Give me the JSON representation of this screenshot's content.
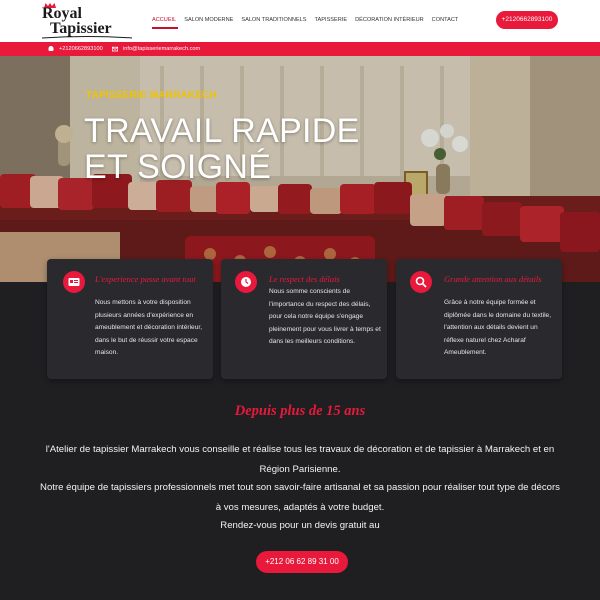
{
  "header": {
    "logo_line1": "Royal",
    "logo_line2": "Tapissier",
    "nav": [
      {
        "label": "Accueil"
      },
      {
        "label": "Salon moderne"
      },
      {
        "label": "Salon traditionnels"
      },
      {
        "label": "Tapisserie"
      },
      {
        "label": "Décoration intérieur"
      },
      {
        "label": "Contact"
      }
    ],
    "phone_button": "+2120662893100"
  },
  "topbar": {
    "phone": "+2120662893100",
    "email": "info@tapisseriemarrakech.com",
    "phone_icon": "phone-icon",
    "email_icon": "envelope-icon"
  },
  "hero": {
    "eyebrow": "TAPISSERIE MARRAKECH",
    "title": "TRAVAIL RAPIDE ET SOIGNÉ"
  },
  "features": [
    {
      "icon": "id-card-icon",
      "title": "L'experience passe avant tout",
      "text": "Nous mettons à votre disposition plusieurs années d'expérience en ameublement et décoration intérieur, dans le but de réussir votre espace maison."
    },
    {
      "icon": "clock-icon",
      "title": "Le respect des délais",
      "text": "Nous somme conscients de l'importance du respect des délais, pour cela notre équipe s'engage pleinement pour vous livrer à temps et dans les meilleurs conditions."
    },
    {
      "icon": "search-icon",
      "title": "Grande attention aux détails",
      "text": "Grâce à notre équipe formée et diplômée dans le domaine du textile, l'attention aux détails devient un réflexe naturel chez Acharaf Ameublement."
    }
  ],
  "about": {
    "title": "Depuis plus de 15 ans",
    "p1": "l'Atelier de tapissier Marrakech vous conseille et réalise tous les travaux de décoration et de tapissier à Marrakech et en Région Parisienne.",
    "p2": "Notre équipe de tapissiers professionnels met tout son savoir-faire artisanal et sa passion pour réaliser tout type de décors à vos mesures, adaptés à votre budget.",
    "p3": "Rendez-vous pour un devis gratuit au",
    "cta": "+212 06 62 89 31 00"
  },
  "colors": {
    "accent": "#e8193b",
    "dark_bg": "#1f1f22",
    "card_bg": "#2a2a2e",
    "eyebrow": "#f0c300"
  }
}
